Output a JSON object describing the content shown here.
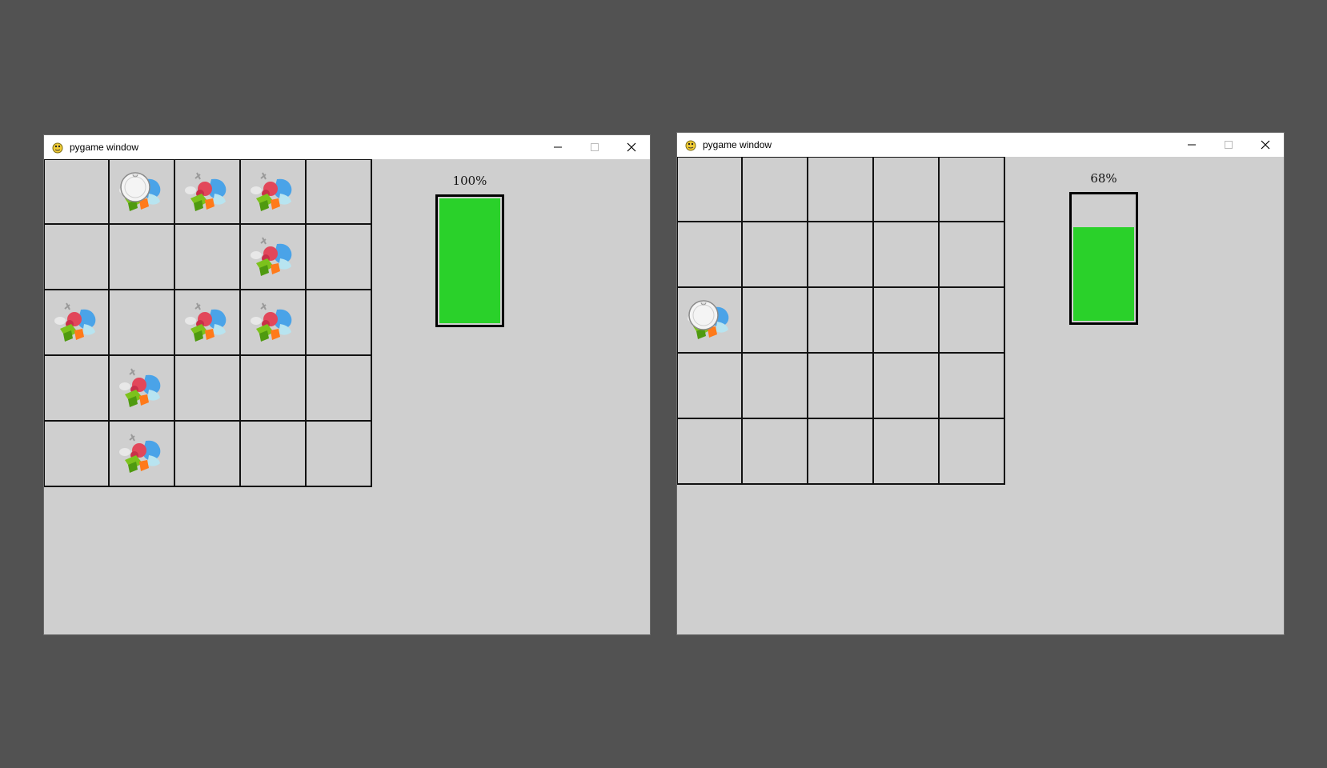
{
  "windows": [
    {
      "title": "pygame window",
      "battery": {
        "label": "100%",
        "level": 1.0,
        "color": "#2ad12a"
      },
      "grid": {
        "rows": 5,
        "cols": 5,
        "robot": {
          "row": 0,
          "col": 1
        },
        "dirt": [
          [
            0,
            1
          ],
          [
            0,
            2
          ],
          [
            0,
            3
          ],
          [
            1,
            3
          ],
          [
            2,
            0
          ],
          [
            2,
            2
          ],
          [
            2,
            3
          ],
          [
            3,
            1
          ],
          [
            4,
            1
          ]
        ]
      }
    },
    {
      "title": "pygame window",
      "battery": {
        "label": "68%",
        "level": 0.75,
        "color": "#2ad12a"
      },
      "grid": {
        "rows": 5,
        "cols": 5,
        "robot": {
          "row": 2,
          "col": 0
        },
        "dirt": [
          [
            2,
            0
          ]
        ]
      }
    }
  ],
  "icons": {
    "app": "pygame-snake-icon",
    "minimize": "minimize-icon",
    "maximize": "maximize-icon",
    "close": "close-icon",
    "robot": "robot-vacuum-icon",
    "dirt": "dirt-pile-icon"
  },
  "colors": {
    "desktop": "#525252",
    "client": "#cfcfcf",
    "battery_fill": "#2ad12a",
    "grid_line": "#111111"
  }
}
